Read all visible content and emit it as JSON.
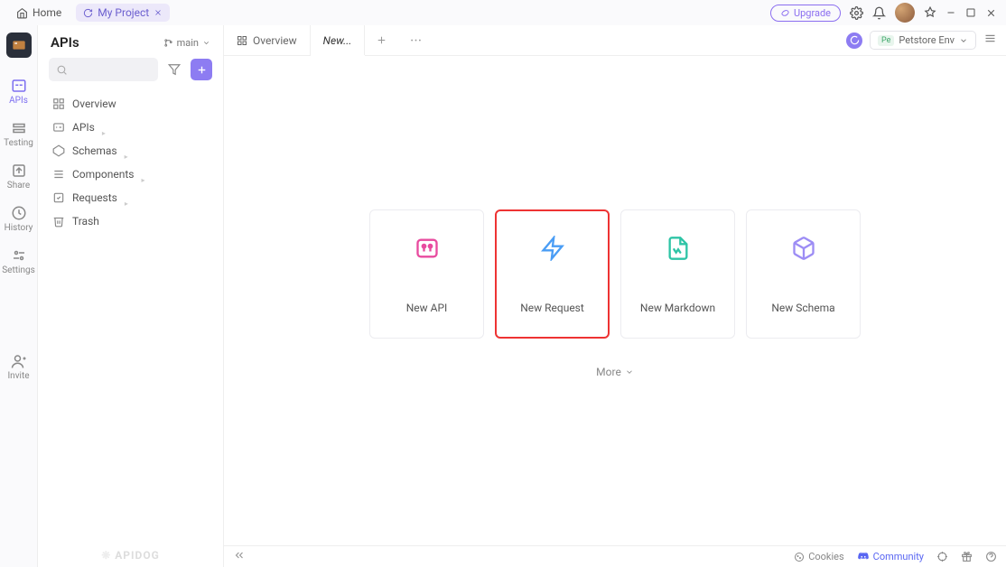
{
  "topbar": {
    "home_label": "Home",
    "project_name": "My Project",
    "upgrade_label": "Upgrade"
  },
  "rail": {
    "apis": "APIs",
    "testing": "Testing",
    "share": "Share",
    "history": "History",
    "settings": "Settings",
    "invite": "Invite"
  },
  "sidebar": {
    "title": "APIs",
    "branch": "main",
    "tree": {
      "overview": "Overview",
      "apis": "APIs",
      "schemas": "Schemas",
      "components": "Components",
      "requests": "Requests",
      "trash": "Trash"
    },
    "brand": "APIDOG"
  },
  "tabs": {
    "overview": "Overview",
    "new": "New..."
  },
  "env": {
    "name": "Petstore Env",
    "tag": "Pe"
  },
  "cards": {
    "new_api": "New API",
    "new_request": "New Request",
    "new_markdown": "New Markdown",
    "new_schema": "New Schema",
    "more": "More"
  },
  "statusbar": {
    "cookies": "Cookies",
    "community": "Community"
  }
}
